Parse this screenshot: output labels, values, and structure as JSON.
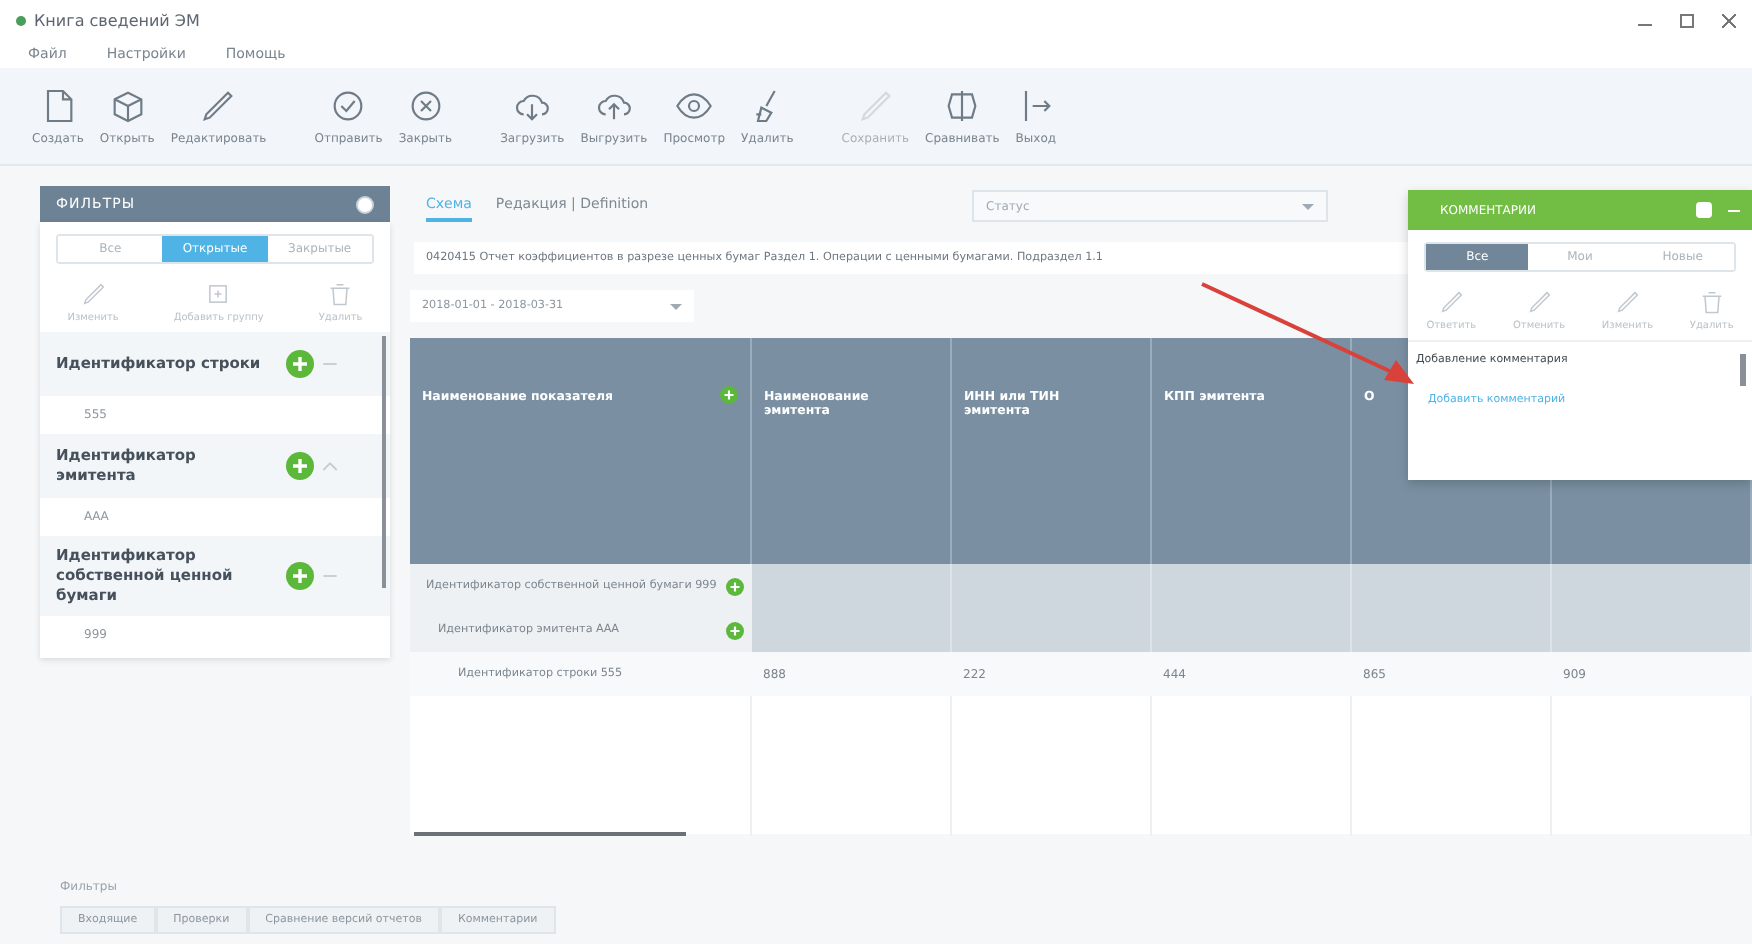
{
  "window": {
    "title": "Книга сведений ЭМ"
  },
  "menu": [
    "Файл",
    "Настройки",
    "Помощь"
  ],
  "toolbar": [
    {
      "label": "Создать",
      "kind": "new",
      "disabled": false
    },
    {
      "label": "Открыть",
      "kind": "box",
      "disabled": false
    },
    {
      "label": "Редактировать",
      "kind": "pen",
      "disabled": false
    },
    {
      "label": "Отправить",
      "kind": "check",
      "disabled": false
    },
    {
      "label": "Закрыть",
      "kind": "close",
      "disabled": false
    },
    {
      "label": "Загрузить",
      "kind": "down",
      "disabled": false
    },
    {
      "label": "Выгрузить",
      "kind": "up",
      "disabled": false
    },
    {
      "label": "Просмотр",
      "kind": "eye",
      "disabled": false
    },
    {
      "label": "Удалить",
      "kind": "broom",
      "disabled": false
    },
    {
      "label": "Сохранить",
      "kind": "pen",
      "disabled": true
    },
    {
      "label": "Сравнивать",
      "kind": "compare",
      "disabled": false
    },
    {
      "label": "Выход",
      "kind": "exit",
      "disabled": false
    }
  ],
  "filters": {
    "title": "ФИЛЬТРЫ",
    "segments": [
      {
        "label": "Все",
        "selected": false
      },
      {
        "label": "Открытые",
        "selected": true
      },
      {
        "label": "Закрытые",
        "selected": false
      }
    ],
    "actions": [
      {
        "label": "Изменить",
        "kind": "pen"
      },
      {
        "label": "Добавить группу",
        "kind": "group"
      },
      {
        "label": "Удалить",
        "kind": "trash"
      }
    ],
    "items": [
      {
        "label": "Идентификатор строки",
        "value": "555",
        "expanded": false
      },
      {
        "label": "Идентификатор эмитента",
        "value": "ААА",
        "expanded": true
      },
      {
        "label": "Идентификатор собственной ценной бумаги",
        "value": "999",
        "expanded": false
      }
    ]
  },
  "tabs": [
    {
      "label": "Схема",
      "selected": true
    },
    {
      "label": "Редакция | Definition",
      "selected": false
    }
  ],
  "status_select": {
    "placeholder": "Статус"
  },
  "description": "0420415 Отчет коэффициентов в разрезе ценных бумаг Раздел 1. Операции с ценными бумагами. Подраздел 1.1",
  "period": "2018-01-01 - 2018-03-31",
  "table": {
    "columns": [
      "Наименование показателя",
      "Наименование эмитента",
      "ИНН или ТИН эмитента",
      "КПП эмитента",
      "О"
    ],
    "groups": [
      {
        "label": "Идентификатор собственной ценной бумаги 999",
        "children": [
          {
            "label": "Идентификатор эмитента ААА"
          }
        ]
      }
    ],
    "rows": [
      {
        "cells": [
          "Идентификатор строки 555",
          "888",
          "222",
          "444",
          "865",
          "909"
        ]
      }
    ]
  },
  "comments": {
    "title": "КОММЕНТАРИИ",
    "segments": [
      {
        "label": "Все",
        "selected": true
      },
      {
        "label": "Мои",
        "selected": false
      },
      {
        "label": "Новые",
        "selected": false
      }
    ],
    "actions": [
      {
        "label": "Ответить",
        "kind": "pen"
      },
      {
        "label": "Отменить",
        "kind": "pen"
      },
      {
        "label": "Изменить",
        "kind": "pen"
      },
      {
        "label": "Удалить",
        "kind": "trash"
      }
    ],
    "text": "Добавление комментария",
    "link": "Добавить комментарий"
  },
  "bottom": {
    "label": "Фильтры",
    "tabs": [
      "Входящие",
      "Проверки",
      "Сравнение версий отчетов",
      "Комментарии"
    ]
  }
}
